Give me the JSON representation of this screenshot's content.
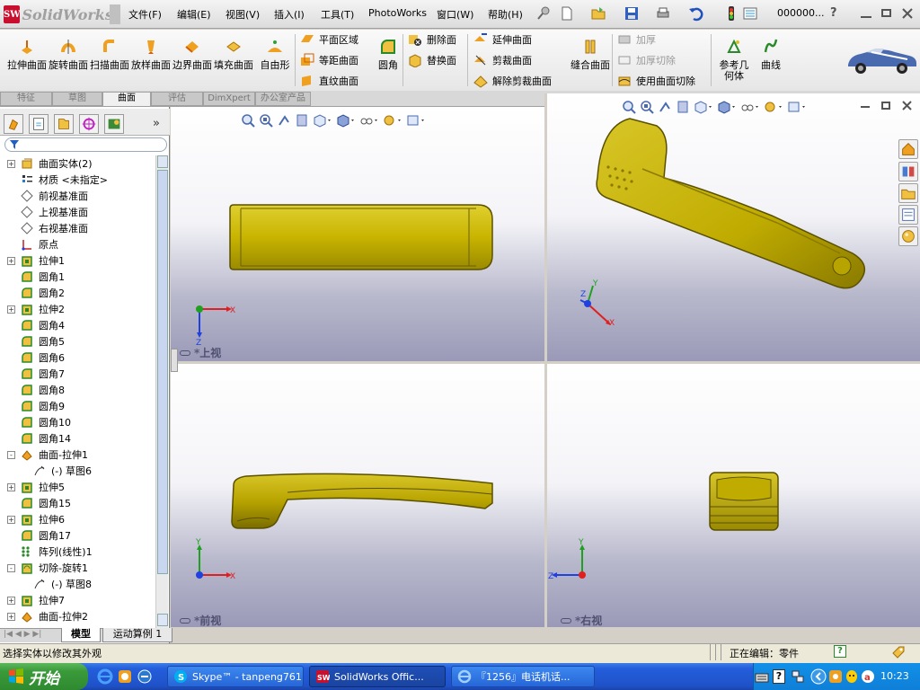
{
  "app": {
    "logo_badge": "SW",
    "name": "SolidWorks",
    "menu": [
      "文件(F)",
      "编辑(E)",
      "视图(V)",
      "插入(I)",
      "工具(T)",
      "PhotoWorks",
      "窗口(W)",
      "帮助(H)"
    ],
    "title_field": "000000...",
    "help_glyph": "?"
  },
  "command_manager": {
    "big_buttons": [
      "拉伸曲面",
      "旋转曲面",
      "扫描曲面",
      "放样曲面",
      "边界曲面",
      "填充曲面",
      "自由形"
    ],
    "col1": [
      "平面区域",
      "等距曲面",
      "直纹曲面"
    ],
    "fillet": "圆角",
    "col2": [
      "删除面",
      "替换面"
    ],
    "col3": [
      "延伸曲面",
      "剪裁曲面",
      "解除剪裁曲面"
    ],
    "knit": "缝合曲面",
    "thicken_group": [
      "加厚",
      "加厚切除",
      "使用曲面切除"
    ],
    "ref_geometry": "参考几何体",
    "curves": "曲线"
  },
  "tabs": [
    "特征",
    "草图",
    "曲面",
    "评估",
    "DimXpert",
    "办公室产品"
  ],
  "active_tab": "曲面",
  "feature_tree": [
    {
      "label": "曲面实体(2)",
      "expand": "+",
      "icon": "surface-bodies-icon"
    },
    {
      "label": "材质 <未指定>",
      "expand": "",
      "icon": "material-icon"
    },
    {
      "label": "前视基准面",
      "expand": "",
      "icon": "plane-icon"
    },
    {
      "label": "上视基准面",
      "expand": "",
      "icon": "plane-icon"
    },
    {
      "label": "右视基准面",
      "expand": "",
      "icon": "plane-icon"
    },
    {
      "label": "原点",
      "expand": "",
      "icon": "origin-icon"
    },
    {
      "label": "拉伸1",
      "expand": "+",
      "icon": "extrude-icon"
    },
    {
      "label": "圆角1",
      "expand": "",
      "icon": "fillet-icon"
    },
    {
      "label": "圆角2",
      "expand": "",
      "icon": "fillet-icon"
    },
    {
      "label": "拉伸2",
      "expand": "+",
      "icon": "extrude-icon"
    },
    {
      "label": "圆角4",
      "expand": "",
      "icon": "fillet-icon"
    },
    {
      "label": "圆角5",
      "expand": "",
      "icon": "fillet-icon"
    },
    {
      "label": "圆角6",
      "expand": "",
      "icon": "fillet-icon"
    },
    {
      "label": "圆角7",
      "expand": "",
      "icon": "fillet-icon"
    },
    {
      "label": "圆角8",
      "expand": "",
      "icon": "fillet-icon"
    },
    {
      "label": "圆角9",
      "expand": "",
      "icon": "fillet-icon"
    },
    {
      "label": "圆角10",
      "expand": "",
      "icon": "fillet-icon"
    },
    {
      "label": "圆角14",
      "expand": "",
      "icon": "fillet-icon"
    },
    {
      "label": "曲面-拉伸1",
      "expand": "-",
      "icon": "surface-extrude-icon"
    },
    {
      "label": "(-) 草图6",
      "expand": "",
      "icon": "sketch-icon",
      "sub": true
    },
    {
      "label": "拉伸5",
      "expand": "+",
      "icon": "extrude-icon"
    },
    {
      "label": "圆角15",
      "expand": "",
      "icon": "fillet-icon"
    },
    {
      "label": "拉伸6",
      "expand": "+",
      "icon": "extrude-icon"
    },
    {
      "label": "圆角17",
      "expand": "",
      "icon": "fillet-icon"
    },
    {
      "label": "阵列(线性)1",
      "expand": "",
      "icon": "linear-pattern-icon"
    },
    {
      "label": "切除-旋转1",
      "expand": "-",
      "icon": "cut-revolve-icon"
    },
    {
      "label": "(-) 草图8",
      "expand": "",
      "icon": "sketch-icon",
      "sub": true
    },
    {
      "label": "拉伸7",
      "expand": "+",
      "icon": "extrude-icon"
    },
    {
      "label": "曲面-拉伸2",
      "expand": "+",
      "icon": "surface-extrude-icon"
    }
  ],
  "bottom_tabs": [
    "模型",
    "运动算例 1"
  ],
  "viewports": {
    "top_left": {
      "label": "*上视",
      "axes": [
        "X",
        "Z"
      ]
    },
    "top_right": {
      "label": "",
      "axes": [
        "X",
        "Y",
        "Z"
      ]
    },
    "bottom_left": {
      "label": "*前视",
      "axes": [
        "X",
        "Y"
      ]
    },
    "bottom_right": {
      "label": "*右视",
      "axes": [
        "Z",
        "Y"
      ]
    }
  },
  "status": {
    "left": "选择实体以修改其外观",
    "editing": "正在编辑：零件",
    "help_glyph": "?"
  },
  "taskbar": {
    "start": "开始",
    "tasks": [
      "Skype™ - tanpeng761",
      "SolidWorks Offic...",
      "『1256』电话机话..."
    ],
    "clock": "10:23"
  },
  "colors": {
    "part": "#c8b400",
    "part_dark": "#8a7a00",
    "accent": "#245edb"
  }
}
